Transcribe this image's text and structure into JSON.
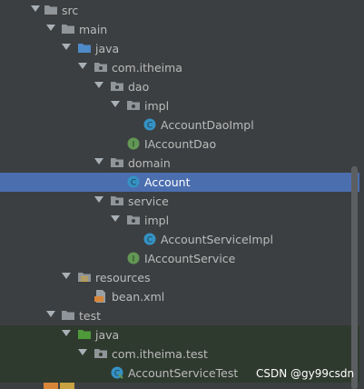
{
  "tree": {
    "src": "src",
    "main": "main",
    "java_main": "java",
    "pkg_main": "com.itheima",
    "dao": "dao",
    "dao_impl": "impl",
    "account_dao_impl": "AccountDaoImpl",
    "iaccount_dao": "IAccountDao",
    "domain": "domain",
    "account": "Account",
    "service": "service",
    "service_impl": "impl",
    "account_service_impl": "AccountServiceImpl",
    "iaccount_service": "IAccountService",
    "resources": "resources",
    "bean_xml": "bean.xml",
    "test": "test",
    "java_test": "java",
    "pkg_test": "com.itheima.test",
    "account_service_test": "AccountServiceTest"
  },
  "icons": {
    "class_letter": "C",
    "interface_letter": "I"
  },
  "colors": {
    "background": "#3c3f41",
    "selection": "#4b6eaf",
    "class_icon": "#3592c4",
    "interface_icon": "#629755",
    "folder": "#8f9599",
    "source_folder": "#4e8bc8",
    "test_folder": "#4e9a3a",
    "test_row_bg": "#2f3a2f"
  },
  "watermark": "CSDN @gy99csdn"
}
